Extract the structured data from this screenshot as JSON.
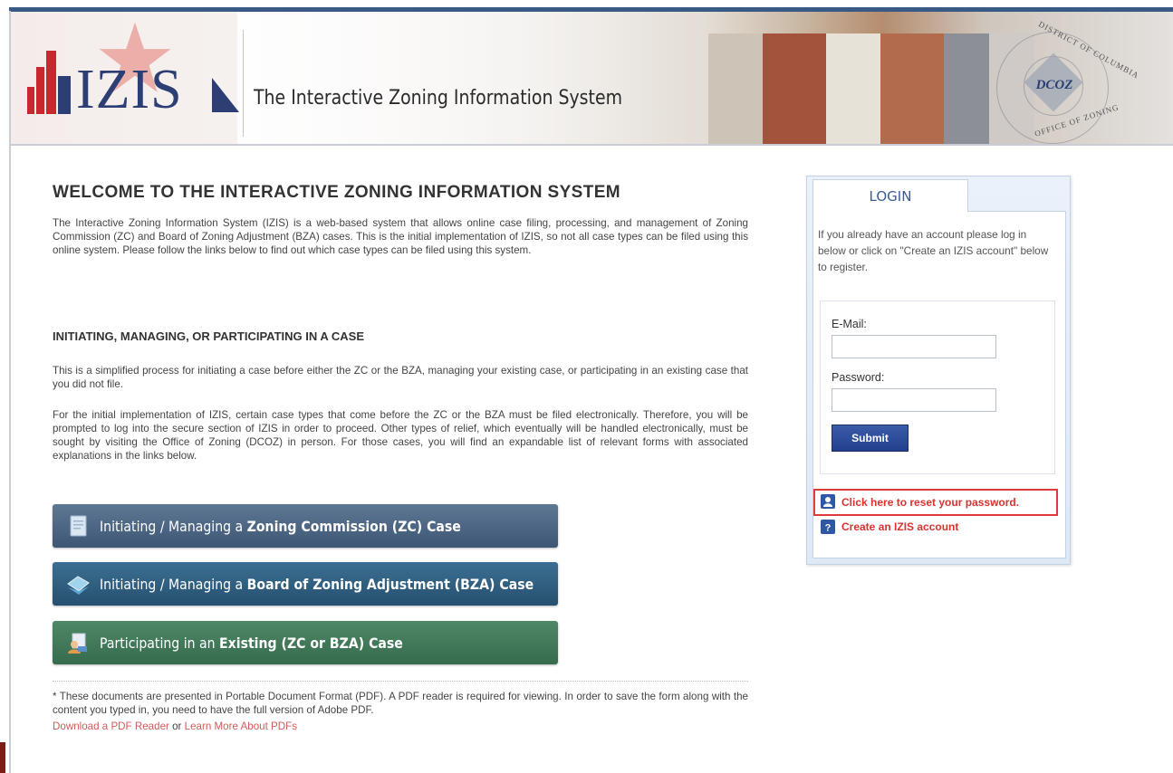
{
  "header": {
    "logo_text": "IZIS",
    "tagline": "The Interactive Zoning Information System",
    "seal": {
      "center": "DCOZ",
      "ring_top": "DISTRICT OF COLUMBIA",
      "ring_bottom": "OFFICE OF ZONING"
    }
  },
  "welcome": {
    "title": "WELCOME TO THE INTERACTIVE ZONING INFORMATION SYSTEM",
    "intro": "The Interactive Zoning Information System (IZIS) is a web-based system that allows online case filing, processing, and management of Zoning Commission (ZC) and Board of Zoning Adjustment (BZA) cases. This is the initial implementation of IZIS, so not all case types can be filed using this online system. Please follow the links below to find out which case types can be filed using this system."
  },
  "section": {
    "title": "INITIATING, MANAGING, OR PARTICIPATING IN A CASE",
    "para1": "This is a simplified process for initiating a case before either the ZC or the BZA, managing your existing case, or participating in an existing case that you did not file.",
    "para2": "For the initial implementation of IZIS, certain case types that come before the ZC or the BZA must be filed electronically. Therefore, you will be prompted to log into the secure section of IZIS in order to proceed. Other types of relief, which eventually will be handled electronically, must be sought by visiting the Office of Zoning (DCOZ) in person. For those cases, you will find an expandable list of relevant forms with associated explanations in the links below."
  },
  "case_buttons": {
    "zc": {
      "prefix": "Initiating / Managing a ",
      "bold": "Zoning Commission (ZC) Case",
      "icon": "document-icon"
    },
    "bza": {
      "prefix": "Initiating / Managing a ",
      "bold": "Board of Zoning Adjustment (BZA) Case",
      "icon": "stack-icon"
    },
    "existing": {
      "prefix": "Participating in an ",
      "bold": "Existing (ZC or BZA) Case",
      "icon": "people-icon"
    }
  },
  "footnote": {
    "text": "* These documents are presented in Portable Document Format (PDF). A PDF reader is required for viewing. In order to save the form along with the content you typed in, you need to have the full version of Adobe PDF.",
    "link1": "Download a PDF Reader",
    "connector": " or ",
    "link2": "Learn More About PDFs"
  },
  "login": {
    "tab_label": "LOGIN",
    "intro": "If you already have an account please log in below or click on \"Create an IZIS account\" below to register.",
    "email_label": "E-Mail:",
    "email_value": "",
    "password_label": "Password:",
    "password_value": "",
    "submit_label": "Submit",
    "reset_link": "Click here to reset your password.",
    "create_link": "Create an IZIS account"
  },
  "colors": {
    "brand_blue": "#2c3e74",
    "brand_red": "#c8282d",
    "link_red": "#d9322f",
    "zc_button": "#4a6482",
    "bza_button": "#2f5e80",
    "existing_button": "#437a5b",
    "highlight_border": "#e03a3a"
  }
}
